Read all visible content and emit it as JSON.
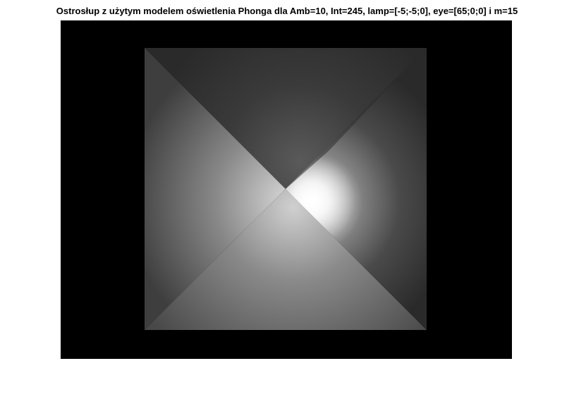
{
  "figure": {
    "title": "Ostrosłup z użytym modelem oświetlenia Phonga dla Amb=10, Int=245, lamp=[-5;-5;0], eye=[65;0;0] i m=15"
  },
  "colors": {
    "background": "#000000",
    "page": "#ffffff",
    "top_face": "#2e2e2e",
    "right_face": "#2b2b2b",
    "left_face": "#464646",
    "bottom_face": "#4e4e4e",
    "highlight": "#ffffff"
  }
}
